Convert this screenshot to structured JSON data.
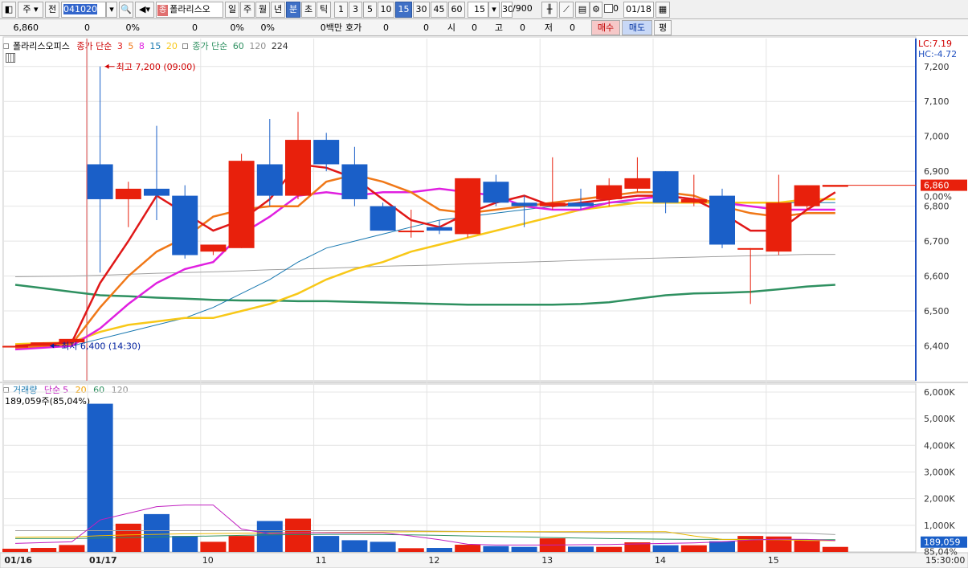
{
  "toolbar": {
    "market": "주",
    "prefix": "전",
    "code": "041020",
    "stock_name": "폴라리스오",
    "name_tag": "종",
    "periods": [
      "일",
      "주",
      "월",
      "년",
      "분",
      "초",
      "틱"
    ],
    "selected_period": "분",
    "intervals": [
      "1",
      "3",
      "5",
      "10",
      "15",
      "30",
      "45",
      "60"
    ],
    "selected_interval": "15",
    "interval_value": "15",
    "count_value": "30",
    "count_total": "/900",
    "zero_checkbox_label": "0",
    "date_value": "01/18"
  },
  "quote": {
    "price": "6,860",
    "change": "0",
    "change_pct": "0%",
    "v1": "0",
    "v1_pct": "0%",
    "v2_pct": "0%",
    "trade_amount": "0백만",
    "bid_label": "호가",
    "bid_value": "0",
    "bid_value2": "0",
    "open_label": "시",
    "open_value": "0",
    "high_label": "고",
    "high_value": "0",
    "low_label": "저",
    "low_value": "0",
    "buy_button": "매수",
    "sell_button": "매도",
    "avg_button": "평"
  },
  "price_legend": {
    "stock": "폴라리스오피스",
    "ma_short_label": "종가 단순",
    "ma_short_periods": [
      "3",
      "5",
      "8",
      "15",
      "20"
    ],
    "ma_long_label": "종가 단순",
    "ma_long_periods": [
      "60",
      "120",
      "224"
    ]
  },
  "volume_legend": {
    "label": "거래량",
    "ma_label": "단순",
    "periods": [
      "5",
      "20",
      "60",
      "120"
    ],
    "current": "189,059주(85,04%)"
  },
  "annotations": {
    "high": "최고 7,200 (09:00)",
    "low": "최저 6,400 (14:30)",
    "lc": "LC:7.19",
    "hc": "HC:-4.72",
    "price_tag": "6,860",
    "pct_tag": "0,00%",
    "vol_tag": "189,059",
    "vol_pct_tag": "85,04%",
    "time_tag": "15:30:00"
  },
  "colors": {
    "up": "#e8200c",
    "down": "#1a5fc8",
    "ma3": "#e01818",
    "ma5": "#f07818",
    "ma8": "#e020e0",
    "ma15": "#1878b0",
    "ma20": "#f8c818",
    "ma60": "#2e9060",
    "ma120": "#a0a0a0",
    "ma224": "#303030"
  },
  "chart_data": {
    "type": "candlestick",
    "price_axis": {
      "ticks": [
        "7,200",
        "7,100",
        "7,000",
        "6,900",
        "6,800",
        "6,700",
        "6,600",
        "6,500",
        "6,400"
      ],
      "range": [
        6300,
        7280
      ]
    },
    "volume_axis": {
      "ticks": [
        "6,000K",
        "5,000K",
        "4,000K",
        "3,000K",
        "2,000K",
        "1,000K"
      ],
      "range": [
        0,
        6300
      ]
    },
    "x_labels": [
      {
        "label": "01/16",
        "index": 0
      },
      {
        "label": "01/17",
        "index": 3
      },
      {
        "label": "10",
        "index": 7
      },
      {
        "label": "11",
        "index": 11
      },
      {
        "label": "12",
        "index": 15
      },
      {
        "label": "13",
        "index": 19
      },
      {
        "label": "14",
        "index": 23
      },
      {
        "label": "15",
        "index": 27
      }
    ],
    "candles": [
      {
        "o": 6400,
        "h": 6400,
        "l": 6400,
        "c": 6400,
        "v": 120
      },
      {
        "o": 6400,
        "h": 6410,
        "l": 6400,
        "c": 6410,
        "v": 150
      },
      {
        "o": 6410,
        "h": 6420,
        "l": 6400,
        "c": 6420,
        "v": 260
      },
      {
        "o": 6920,
        "h": 7200,
        "l": 6610,
        "c": 6820,
        "v": 5560
      },
      {
        "o": 6820,
        "h": 6870,
        "l": 6740,
        "c": 6850,
        "v": 1060
      },
      {
        "o": 6850,
        "h": 7030,
        "l": 6760,
        "c": 6830,
        "v": 1420
      },
      {
        "o": 6830,
        "h": 6860,
        "l": 6650,
        "c": 6660,
        "v": 600
      },
      {
        "o": 6670,
        "h": 6690,
        "l": 6660,
        "c": 6690,
        "v": 380
      },
      {
        "o": 6680,
        "h": 6950,
        "l": 6680,
        "c": 6930,
        "v": 600
      },
      {
        "o": 6920,
        "h": 7050,
        "l": 6800,
        "c": 6830,
        "v": 1160
      },
      {
        "o": 6830,
        "h": 7070,
        "l": 6820,
        "c": 6990,
        "v": 1250
      },
      {
        "o": 6990,
        "h": 7010,
        "l": 6900,
        "c": 6920,
        "v": 600
      },
      {
        "o": 6920,
        "h": 6970,
        "l": 6800,
        "c": 6820,
        "v": 440
      },
      {
        "o": 6800,
        "h": 6810,
        "l": 6730,
        "c": 6730,
        "v": 380
      },
      {
        "o": 6730,
        "h": 6790,
        "l": 6710,
        "c": 6730,
        "v": 140
      },
      {
        "o": 6740,
        "h": 6760,
        "l": 6720,
        "c": 6730,
        "v": 150
      },
      {
        "o": 6720,
        "h": 6880,
        "l": 6710,
        "c": 6880,
        "v": 270
      },
      {
        "o": 6870,
        "h": 6890,
        "l": 6800,
        "c": 6810,
        "v": 220
      },
      {
        "o": 6810,
        "h": 6830,
        "l": 6740,
        "c": 6800,
        "v": 190
      },
      {
        "o": 6800,
        "h": 6940,
        "l": 6790,
        "c": 6810,
        "v": 510
      },
      {
        "o": 6810,
        "h": 6850,
        "l": 6790,
        "c": 6800,
        "v": 200
      },
      {
        "o": 6820,
        "h": 6880,
        "l": 6800,
        "c": 6860,
        "v": 190
      },
      {
        "o": 6850,
        "h": 6940,
        "l": 6840,
        "c": 6880,
        "v": 360
      },
      {
        "o": 6900,
        "h": 6900,
        "l": 6780,
        "c": 6810,
        "v": 250
      },
      {
        "o": 6810,
        "h": 6890,
        "l": 6800,
        "c": 6820,
        "v": 250
      },
      {
        "o": 6830,
        "h": 6850,
        "l": 6680,
        "c": 6690,
        "v": 400
      },
      {
        "o": 6680,
        "h": 6680,
        "l": 6520,
        "c": 6680,
        "v": 600
      },
      {
        "o": 6670,
        "h": 6890,
        "l": 6660,
        "c": 6810,
        "v": 580
      },
      {
        "o": 6800,
        "h": 6860,
        "l": 6790,
        "c": 6860,
        "v": 430
      },
      {
        "o": 6860,
        "h": 6860,
        "l": 6860,
        "c": 6860,
        "v": 189
      }
    ],
    "ma": {
      "ma3": [
        6400,
        6405,
        6410,
        6580,
        6700,
        6830,
        6780,
        6730,
        6760,
        6820,
        6920,
        6910,
        6880,
        6820,
        6760,
        6740,
        6780,
        6810,
        6830,
        6800,
        6810,
        6820,
        6830,
        6830,
        6820,
        6780,
        6730,
        6730,
        6790,
        6840
      ],
      "ma5": [
        6395,
        6400,
        6405,
        6510,
        6600,
        6670,
        6710,
        6770,
        6790,
        6800,
        6800,
        6870,
        6890,
        6870,
        6840,
        6790,
        6780,
        6790,
        6800,
        6810,
        6820,
        6830,
        6840,
        6840,
        6830,
        6800,
        6780,
        6770,
        6780,
        6780
      ],
      "ma8": [
        6390,
        6395,
        6400,
        6450,
        6520,
        6580,
        6620,
        6640,
        6720,
        6770,
        6830,
        6840,
        6830,
        6840,
        6840,
        6850,
        6840,
        6830,
        6800,
        6790,
        6790,
        6810,
        6820,
        6830,
        6820,
        6810,
        6800,
        6790,
        6790,
        6790
      ],
      "ma15": [
        6400,
        6400,
        6400,
        6420,
        6440,
        6460,
        6480,
        6510,
        6550,
        6590,
        6640,
        6680,
        6700,
        6720,
        6740,
        6760,
        6770,
        6780,
        6790,
        6800,
        6800,
        6810,
        6810,
        6810,
        6810,
        6810,
        6810,
        6810,
        6810,
        6810
      ],
      "ma20": [
        6405,
        6408,
        6410,
        6440,
        6460,
        6470,
        6480,
        6480,
        6500,
        6520,
        6550,
        6590,
        6620,
        6640,
        6670,
        6690,
        6710,
        6730,
        6750,
        6770,
        6790,
        6800,
        6810,
        6810,
        6810,
        6810,
        6810,
        6810,
        6820,
        6820
      ],
      "ma60": [
        6575,
        6565,
        6555,
        6545,
        6542,
        6538,
        6535,
        6532,
        6530,
        6530,
        6528,
        6528,
        6526,
        6524,
        6522,
        6520,
        6518,
        6518,
        6518,
        6518,
        6520,
        6525,
        6535,
        6545,
        6550,
        6552,
        6555,
        6562,
        6570,
        6575
      ],
      "ma120": [
        6598,
        6599,
        6600,
        6602,
        6605,
        6608,
        6610,
        6612,
        6615,
        6618,
        6620,
        6622,
        6625,
        6628,
        6630,
        6632,
        6635,
        6638,
        6640,
        6642,
        6645,
        6648,
        6650,
        6652,
        6654,
        6656,
        6658,
        6660,
        6662,
        6662
      ]
    },
    "volume_ma": {
      "ma5": [
        320,
        350,
        380,
        1200,
        1450,
        1700,
        1760,
        1760,
        860,
        680,
        720,
        720,
        720,
        720,
        600,
        460,
        290,
        260,
        260,
        260,
        270,
        280,
        300,
        320,
        340,
        380,
        450,
        480,
        470,
        430
      ],
      "ma20": [
        550,
        560,
        560,
        610,
        640,
        660,
        680,
        690,
        700,
        710,
        720,
        730,
        740,
        750,
        760,
        760,
        760,
        760,
        760,
        760,
        760,
        760,
        760,
        760,
        600,
        470,
        460,
        460,
        430,
        420
      ],
      "ma60": [
        500,
        500,
        500,
        520,
        540,
        560,
        580,
        600,
        620,
        640,
        650,
        660,
        660,
        650,
        640,
        620,
        600,
        580,
        560,
        540,
        520,
        500,
        490,
        480,
        470,
        470,
        470,
        460,
        460,
        460
      ],
      "ma120": [
        800,
        800,
        800,
        800,
        800,
        800,
        800,
        800,
        800,
        800,
        800,
        800,
        800,
        800,
        790,
        780,
        770,
        760,
        750,
        740,
        730,
        720,
        720,
        720,
        720,
        720,
        720,
        710,
        700,
        650
      ]
    }
  }
}
